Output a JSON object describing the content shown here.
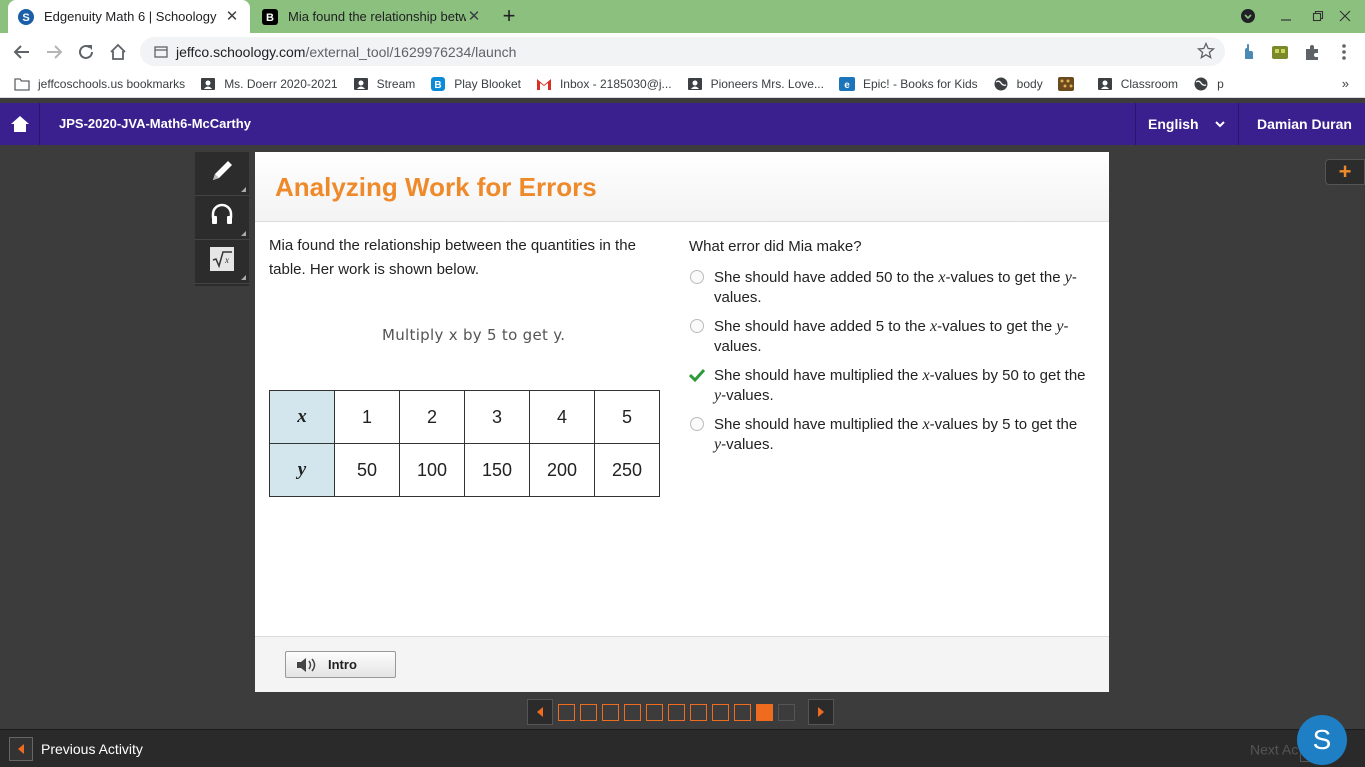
{
  "browser": {
    "tabs": [
      {
        "title": "Edgenuity Math 6 | Schoology",
        "favicon": "schoology-s-icon",
        "active": true
      },
      {
        "title": "Mia found the relationship betw",
        "favicon": "brainly-b-icon",
        "active": false
      }
    ],
    "url_host": "jeffco.schoology.com",
    "url_path": "/external_tool/1629976234/launch",
    "bookmarks": [
      {
        "label": "jeffcoschools.us bookmarks",
        "icon": "folder-icon"
      },
      {
        "label": "Ms. Doerr 2020-2021",
        "icon": "classroom-icon"
      },
      {
        "label": "Stream",
        "icon": "classroom-icon"
      },
      {
        "label": "Play Blooket",
        "icon": "blooket-icon"
      },
      {
        "label": "Inbox - 2185030@j...",
        "icon": "gmail-icon"
      },
      {
        "label": "Pioneers Mrs. Love...",
        "icon": "classroom-icon"
      },
      {
        "label": "Epic! - Books for Kids",
        "icon": "epic-icon"
      },
      {
        "label": "body",
        "icon": "globe-icon"
      },
      {
        "label": "",
        "icon": "pattern-icon"
      },
      {
        "label": "Classroom",
        "icon": "classroom-icon"
      },
      {
        "label": "p",
        "icon": "globe-icon"
      }
    ],
    "bookmarks_more": "»"
  },
  "schoology": {
    "course": "JPS-2020-JVA-Math6-McCarthy",
    "language": "English",
    "user": "Damian Duran"
  },
  "lesson": {
    "title": "Analyzing Work for Errors",
    "prompt": "Mia found the relationship between the quantities in the table. Her work is shown below.",
    "work": "Multiply x by 5 to get y.",
    "table": {
      "x_label": "x",
      "y_label": "y",
      "x_values": [
        "1",
        "2",
        "3",
        "4",
        "5"
      ],
      "y_values": [
        "50",
        "100",
        "150",
        "200",
        "250"
      ]
    },
    "question": "What error did Mia make?",
    "options": [
      {
        "pre": "She should have added 50 to the ",
        "v1": "x",
        "mid": "-values to get the ",
        "v2": "y",
        "post": "-values.",
        "selected": false
      },
      {
        "pre": "She should have added 5 to the ",
        "v1": "x",
        "mid": "-values to get the ",
        "v2": "y",
        "post": "-values.",
        "selected": false
      },
      {
        "pre": "She should have multiplied the ",
        "v1": "x",
        "mid": "-values by 50 to get the ",
        "v2": "y",
        "post": "-values.",
        "selected": true
      },
      {
        "pre": "She should have multiplied the ",
        "v1": "x",
        "mid": "-values by 5 to get the ",
        "v2": "y",
        "post": "-values.",
        "selected": false
      }
    ],
    "intro_label": "Intro"
  },
  "pager": {
    "total": 11,
    "current": 10,
    "locked_from": 11
  },
  "footer": {
    "previous": "Previous Activity",
    "next": "Next Ac"
  },
  "avatar_letter": "S",
  "colors": {
    "accent_orange": "#ef8a2b",
    "schoology_purple": "#3a1f8f",
    "tab_green": "#8cc07e",
    "check_green": "#2e9a3a",
    "table_header": "#d3e6ee"
  }
}
